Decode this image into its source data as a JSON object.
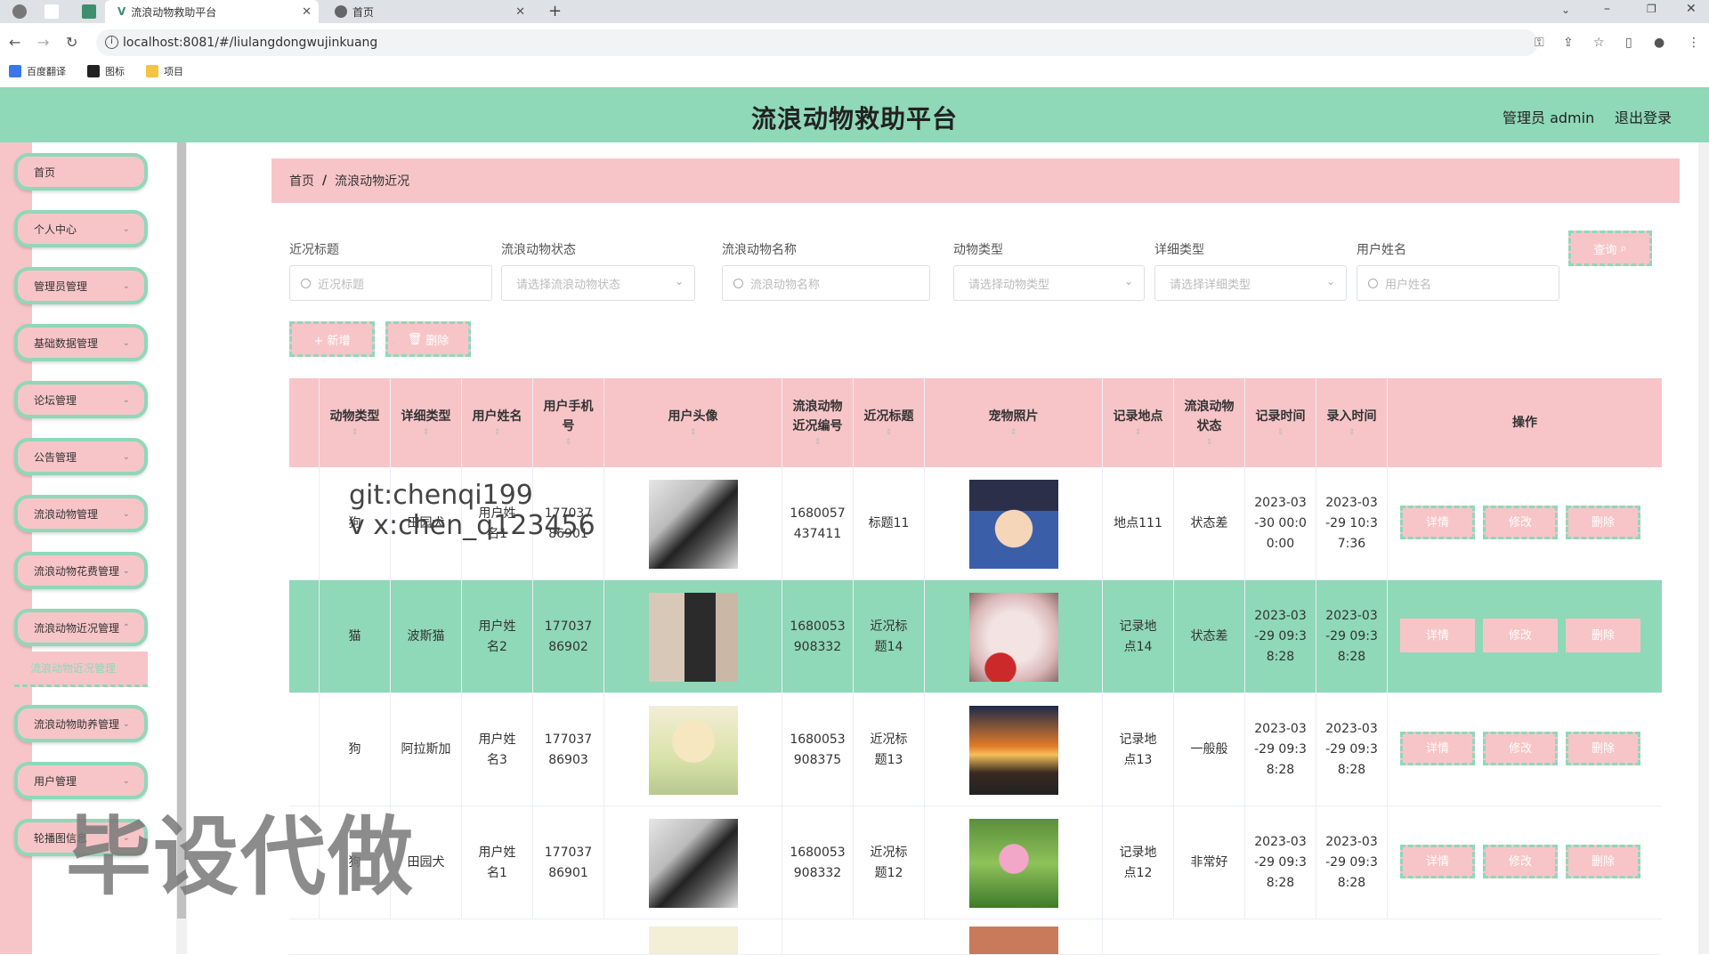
{
  "browser": {
    "tabs": [
      {
        "title": "流浪动物救助平台",
        "active": true
      },
      {
        "title": "首页",
        "active": false
      }
    ],
    "url": "localhost:8081/#/liulangdongwujinkuang",
    "bookmarks": [
      "百度翻译",
      "图标",
      "项目"
    ]
  },
  "header": {
    "title": "流浪动物救助平台",
    "admin": "管理员 admin",
    "logout": "退出登录"
  },
  "sidebar": {
    "items": [
      "首页",
      "个人中心",
      "管理员管理",
      "基础数据管理",
      "论坛管理",
      "公告管理",
      "流浪动物管理",
      "流浪动物花费管理",
      "流浪动物近况管理",
      "流浪动物助养管理",
      "用户管理",
      "轮播图信息"
    ],
    "sub_item": "流浪动物近况管理"
  },
  "breadcrumb": {
    "home": "首页",
    "sep": "/",
    "current": "流浪动物近况"
  },
  "filters": {
    "labels": [
      "近况标题",
      "流浪动物状态",
      "流浪动物名称",
      "动物类型",
      "详细类型",
      "用户姓名"
    ],
    "placeholders": [
      "近况标题",
      "请选择流浪动物状态",
      "流浪动物名称",
      "请选择动物类型",
      "请选择详细类型",
      "用户姓名"
    ],
    "query": "查询"
  },
  "actions": {
    "add": "+ 新增",
    "delete": "删除"
  },
  "table": {
    "headers": [
      "动物类型",
      "详细类型",
      "用户姓名",
      "用户手机号",
      "用户头像",
      "流浪动物近况编号",
      "近况标题",
      "宠物照片",
      "记录地点",
      "流浪动物状态",
      "记录时间",
      "录入时间",
      "操作"
    ],
    "ops": [
      "详情",
      "修改",
      "删除"
    ],
    "rows": [
      {
        "animal_type": "狗",
        "detail_type": "田园犬",
        "user_name": "用户姓名1",
        "phone": "17703786901",
        "code": "1680057437411",
        "title": "标题11",
        "place": "地点111",
        "status": "状态差",
        "record_time": "2023-03-30 00:00:00",
        "entry_time": "2023-03-29 10:37:36"
      },
      {
        "animal_type": "猫",
        "detail_type": "波斯猫",
        "user_name": "用户姓名2",
        "phone": "17703786902",
        "code": "1680053908332",
        "title": "近况标题14",
        "place": "记录地点14",
        "status": "状态差",
        "record_time": "2023-03-29 09:38:28",
        "entry_time": "2023-03-29 09:38:28"
      },
      {
        "animal_type": "狗",
        "detail_type": "阿拉斯加",
        "user_name": "用户姓名3",
        "phone": "17703786903",
        "code": "1680053908375",
        "title": "近况标题13",
        "place": "记录地点13",
        "status": "一般般",
        "record_time": "2023-03-29 09:38:28",
        "entry_time": "2023-03-29 09:38:28"
      },
      {
        "animal_type": "狗",
        "detail_type": "田园犬",
        "user_name": "用户姓名1",
        "phone": "17703786901",
        "code": "1680053908332",
        "title": "近况标题12",
        "place": "记录地点12",
        "status": "非常好",
        "record_time": "2023-03-29 09:38:28",
        "entry_time": "2023-03-29 09:38:28"
      }
    ]
  },
  "watermark": {
    "line1": "git:chenqi199",
    "line2": "v x:chen_q123456",
    "big": "毕设代做"
  },
  "colors": {
    "green": "#8fd8b8",
    "pink": "#f7c5c8"
  }
}
